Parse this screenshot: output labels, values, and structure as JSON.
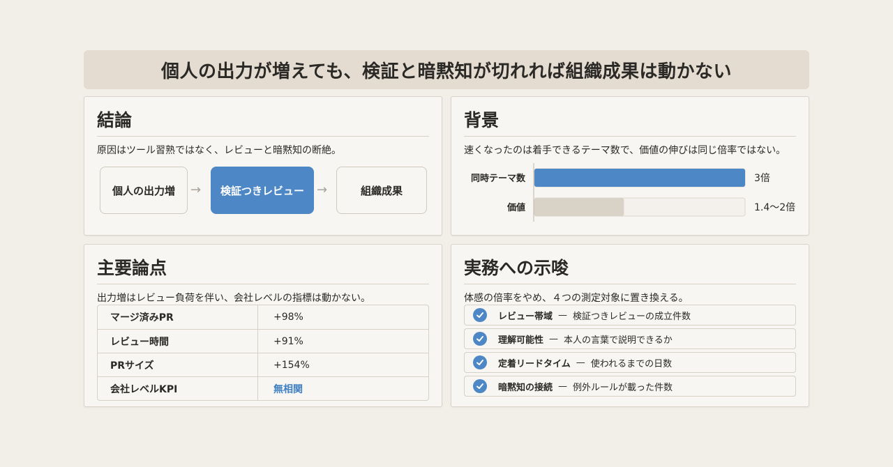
{
  "banner": {
    "title": "個人の出力が増えても、検証と暗黙知が切れれば組織成果は動かない"
  },
  "conclusion": {
    "heading": "結論",
    "subtitle": "原因はツール習熟ではなく、レビューと暗黙知の断絶。",
    "flow": [
      "個人の出力増",
      "検証つきレビュー",
      "組織成果"
    ]
  },
  "background": {
    "heading": "背景",
    "subtitle": "速くなったのは着手できるテーマ数で、価値の伸びは同じ倍率ではない。"
  },
  "chart_data": {
    "type": "bar",
    "orientation": "horizontal",
    "categories": [
      "同時テーマ数",
      "価値"
    ],
    "values": [
      3,
      1.7
    ],
    "value_labels": [
      "3倍",
      "1.4〜2倍"
    ],
    "xlim": [
      0,
      3
    ],
    "colors": [
      "#4d87c6",
      "#d9d2c7"
    ],
    "track_color": "#f4f1ec"
  },
  "points": {
    "heading": "主要論点",
    "subtitle": "出力増はレビュー負荷を伴い、会社レベルの指標は動かない。",
    "rows": [
      {
        "label": "マージ済みPR",
        "value": "+98%"
      },
      {
        "label": "レビュー時間",
        "value": "+91%"
      },
      {
        "label": "PRサイズ",
        "value": "+154%"
      },
      {
        "label": "会社レベルKPI",
        "value": "無相関"
      }
    ],
    "highlight_color": "#3f7fc3"
  },
  "implications": {
    "heading": "実務への示唆",
    "subtitle": "体感の倍率をやめ、４つの測定対象に置き換える。",
    "separator": "—",
    "items": [
      {
        "term": "レビュー帯域",
        "desc": "検証つきレビューの成立件数"
      },
      {
        "term": "理解可能性",
        "desc": "本人の言葉で説明できるか"
      },
      {
        "term": "定着リードタイム",
        "desc": "使われるまでの日数"
      },
      {
        "term": "暗黙知の接続",
        "desc": "例外ルールが載った件数"
      }
    ]
  }
}
